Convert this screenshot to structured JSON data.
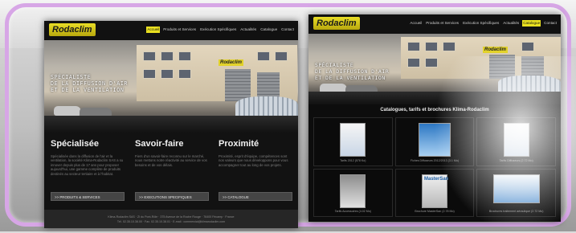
{
  "left_site": {
    "logo": "Rodaclim",
    "nav": [
      "Accueil",
      "Produits et Services",
      "Exécution Spécifiques",
      "Actualités",
      "Catalogue",
      "Contact"
    ],
    "active_nav_index": 0,
    "hero_tagline": [
      "SPÉCIALISTE",
      "DE LA DIFFUSION D'AIR",
      "ET DE LA VENTILATION"
    ],
    "building_sign": "Rodaclim",
    "columns": [
      {
        "title": "Spécialisée",
        "text": "Spécialisée dans la diffusion de l'air et la ventilation, la société Klima-Rodaclim SAS a su innover depuis plus de 17 ans pour proposer aujourd'hui, une gamme complète de produits destinés au secteur tertiaire et à l'habitat.",
        "button": ">> PRODUITS & SERVICES"
      },
      {
        "title": "Savoir-faire",
        "text": "Fiers d'un savoir-faire reconnu sur le marché, nous mettons notre réactivité au service de vos besoins et de vos délais.",
        "button": ">> EXECUTIONS SPECIFIQUES"
      },
      {
        "title": "Proximité",
        "text": "Proximité, esprit d'équipe, compétences sont nos valeurs que nous développons pour vous accompagner tout au long de vos projets.",
        "button": ">> CATALOGUE"
      }
    ],
    "footer": [
      "Klima-Rodaclim SAS · ZI du Pont-Rôle · 375 Avenue de la Roche Rouge · 76400 Fécamp · France",
      "Tél. 02.35.10.38.00 · Fax. 02.35.10.38.01 · E-mail : commercial@klimarodaclim.com"
    ]
  },
  "right_site": {
    "logo": "Rodaclim",
    "nav": [
      "Accueil",
      "Produits et Services",
      "Exécution Spécifiques",
      "Actualités",
      "Catalogue",
      "Contact"
    ],
    "active_nav_index": 4,
    "hero_tagline": [
      "SPÉCIALISTE",
      "DE LA DIFFUSION D'AIR",
      "ET DE LA VENTILATION"
    ],
    "building_sign": "Rodaclim",
    "catalogue_title": "Catalogues, tarifs et brochures Klima-Rodaclim",
    "catalogue_items": [
      {
        "caption": "Tarifs 2012 (578 Ko)",
        "cover_label": "",
        "style": "plain"
      },
      {
        "caption": "Fiches Diffuseurs 2012/2013 (3.1 Mo)",
        "cover_label": "",
        "style": "blue"
      },
      {
        "caption": "Tarifs Diffuseurs (2.72 Mo)",
        "cover_label": "",
        "style": "plain"
      },
      {
        "caption": "Tarifs Accessoires (4.02 Mo)",
        "cover_label": "",
        "style": "gray"
      },
      {
        "caption": "Brochure MasterSan (2.78 Mo)",
        "cover_label": "MasterSan",
        "style": "ms"
      },
      {
        "caption": "Brochures traitement aéraulique (2.72 Mo)",
        "cover_label": "",
        "style": "wide"
      }
    ]
  }
}
